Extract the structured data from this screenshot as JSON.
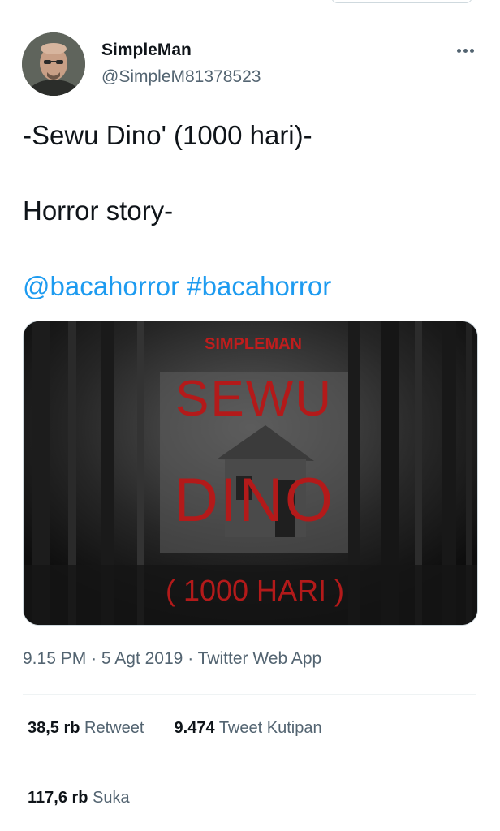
{
  "author": {
    "display_name": "SimpleMan",
    "handle": "@SimpleM81378523"
  },
  "tweet": {
    "line1": "-Sewu Dino' (1000 hari)-",
    "line2": "Horror story-",
    "mention": "@bacahorror",
    "hashtag": "#bacahorror"
  },
  "media": {
    "brand_text": "SIMPLEMAN",
    "title_line1": "SEWU",
    "title_line2": "DINO",
    "subtitle": "( 1000 HARI )",
    "accent_color": "#c01d1d"
  },
  "meta": {
    "time": "9.15 PM",
    "separator": "·",
    "date": "5 Agt 2019",
    "source": "Twitter Web App"
  },
  "stats": {
    "retweets_count": "38,5 rb",
    "retweets_label": "Retweet",
    "quotes_count": "9.474",
    "quotes_label": "Tweet Kutipan",
    "likes_count": "117,6 rb",
    "likes_label": "Suka"
  },
  "icons": {
    "more": "more-horizontal-icon"
  }
}
